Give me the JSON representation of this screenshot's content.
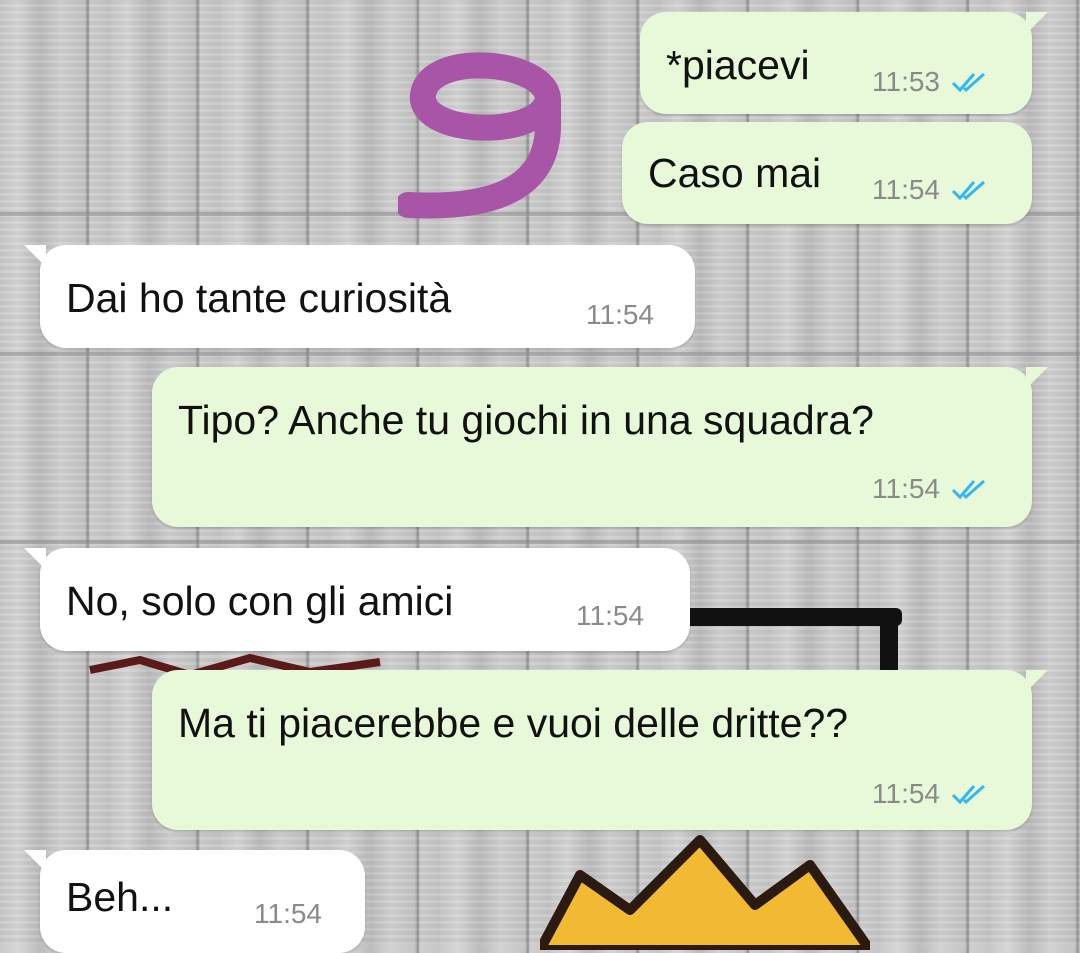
{
  "chat": {
    "messages": [
      {
        "direction": "out",
        "text": "*piacevi",
        "time": "11:53",
        "status": "read"
      },
      {
        "direction": "out",
        "text": "Caso mai",
        "time": "11:54",
        "status": "read"
      },
      {
        "direction": "in",
        "text": "Dai ho tante curiosità",
        "time": "11:54"
      },
      {
        "direction": "out",
        "text": "Tipo? Anche tu giochi in una squadra?",
        "time": "11:54",
        "status": "read"
      },
      {
        "direction": "in",
        "text": "No, solo con gli amici",
        "time": "11:54"
      },
      {
        "direction": "out",
        "text": "Ma ti piacerebbe e vuoi delle dritte??",
        "time": "11:54",
        "status": "read"
      },
      {
        "direction": "in",
        "text": "Beh...",
        "time": "11:54"
      }
    ]
  },
  "colors": {
    "outgoing_bubble": "#e8f9d9",
    "incoming_bubble": "#ffffff",
    "read_tick": "#34b7f1",
    "doodle": "#a855a8"
  },
  "icons": {
    "read_status": "double-check-icon"
  }
}
